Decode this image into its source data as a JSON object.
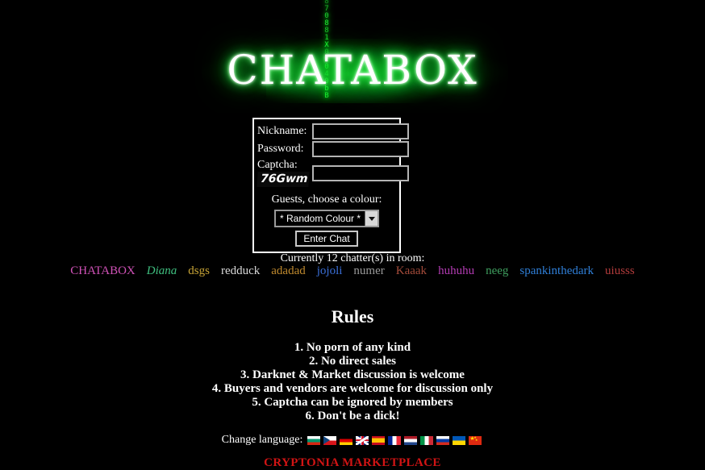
{
  "site": {
    "logo_text": "CHATABOX",
    "matrix_chars": [
      "8",
      "7",
      "0",
      "8",
      "8",
      "1",
      "X",
      "0",
      "E",
      "0",
      "4",
      "0",
      "b",
      "B"
    ]
  },
  "login_form": {
    "nickname_label": "Nickname:",
    "nickname_value": "",
    "nickname_placeholder": "",
    "password_label": "Password:",
    "password_value": "",
    "password_placeholder": "",
    "captcha_label": "Captcha:",
    "captcha_text": "76Gwm",
    "captcha_value": "",
    "captcha_placeholder": "",
    "colour_prompt": "Guests, choose a colour:",
    "colour_selected": "* Random Colour *",
    "colour_options": [
      "* Random Colour *"
    ],
    "submit_label": "Enter Chat"
  },
  "chatters": {
    "count_text": "Currently 12 chatter(s) in room:",
    "count": 12,
    "list": [
      {
        "name": "CHATABOX",
        "color": "#d152b8",
        "style": "normal"
      },
      {
        "name": "Diana",
        "color": "#3fbf7f",
        "style": "italic"
      },
      {
        "name": "dsgs",
        "color": "#c8a436",
        "style": "normal"
      },
      {
        "name": "redduck",
        "color": "#d9d9d9",
        "style": "normal"
      },
      {
        "name": "adadad",
        "color": "#c08a2e",
        "style": "normal"
      },
      {
        "name": "jojoli",
        "color": "#3a6fd8",
        "style": "normal"
      },
      {
        "name": "numer",
        "color": "#9a9a9a",
        "style": "normal"
      },
      {
        "name": "Kaaak",
        "color": "#a34b3a",
        "style": "normal"
      },
      {
        "name": "huhuhu",
        "color": "#b23bb2",
        "style": "normal"
      },
      {
        "name": "neeg",
        "color": "#3f9f5f",
        "style": "normal"
      },
      {
        "name": "spankinthedark",
        "color": "#2f7fd8",
        "style": "normal"
      },
      {
        "name": "uiusss",
        "color": "#b03b3b",
        "style": "normal"
      }
    ]
  },
  "rules": {
    "title": "Rules",
    "items": [
      "1. No porn of any kind",
      "2. No direct sales",
      "3. Darknet & Market discussion is welcome",
      "4. Buyers and vendors are welcome for discussion only",
      "5. Captcha can be ignored by members",
      "6. Don't be a dick!"
    ]
  },
  "language": {
    "label": "Change language:",
    "flags": [
      {
        "name": "flag-bulgaria",
        "code": "bg",
        "type": "h3",
        "c1": "#ffffff",
        "c2": "#00966e",
        "c3": "#d62612"
      },
      {
        "name": "flag-czech",
        "code": "cz",
        "type": "cz"
      },
      {
        "name": "flag-germany",
        "code": "de",
        "type": "h3",
        "c1": "#000000",
        "c2": "#dd0000",
        "c3": "#ffce00"
      },
      {
        "name": "flag-united-kingdom",
        "code": "gb",
        "type": "uk"
      },
      {
        "name": "flag-spain",
        "code": "es",
        "type": "es"
      },
      {
        "name": "flag-france",
        "code": "fr",
        "type": "v3",
        "c1": "#002395",
        "c2": "#ffffff",
        "c3": "#ed2939"
      },
      {
        "name": "flag-netherlands",
        "code": "nl",
        "type": "h3",
        "c1": "#ae1c28",
        "c2": "#ffffff",
        "c3": "#21468b"
      },
      {
        "name": "flag-italy",
        "code": "it",
        "type": "v3",
        "c1": "#009246",
        "c2": "#ffffff",
        "c3": "#ce2b37"
      },
      {
        "name": "flag-russia",
        "code": "ru",
        "type": "ru"
      },
      {
        "name": "flag-ukraine",
        "code": "ua",
        "type": "ua"
      },
      {
        "name": "flag-china",
        "code": "cn",
        "type": "cn"
      }
    ]
  },
  "footer": {
    "link_text": "CRYPTONIA MARKETPLACE",
    "link_color": "#d11414"
  }
}
